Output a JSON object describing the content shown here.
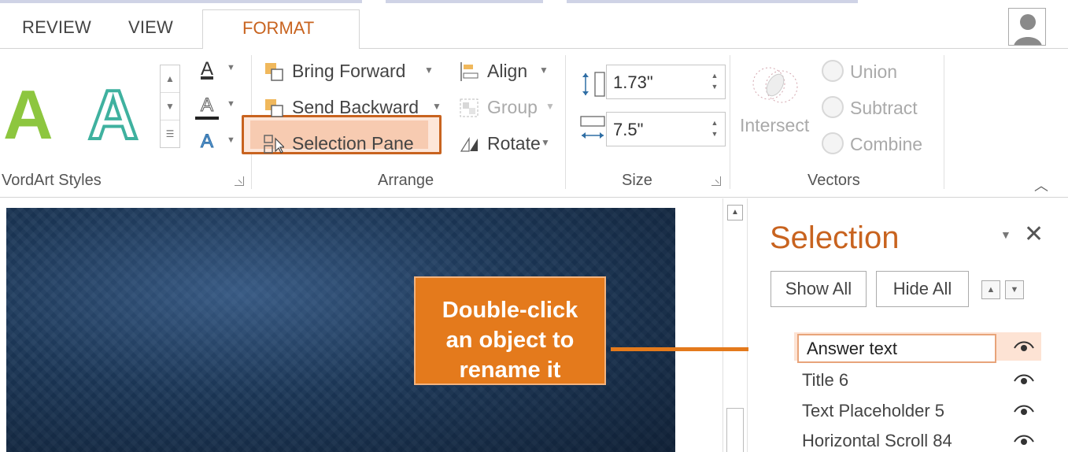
{
  "tabs": [
    {
      "label": "REVIEW"
    },
    {
      "label": "VIEW"
    },
    {
      "label": "FORMAT",
      "active": true
    }
  ],
  "ribbon": {
    "wordart_styles": {
      "label": "VordArt Styles",
      "samples": [
        "A",
        "A"
      ],
      "text_fill_glyph": "A",
      "text_outline_glyph": "A",
      "text_effects_glyph": "A"
    },
    "arrange": {
      "label": "Arrange",
      "bring_forward": "Bring Forward",
      "send_backward": "Send Backward",
      "selection_pane": "Selection Pane",
      "align": "Align",
      "group": "Group",
      "rotate": "Rotate"
    },
    "size": {
      "label": "Size",
      "height": "1.73\"",
      "width": "7.5\""
    },
    "vectors": {
      "label": "Vectors",
      "intersect": "Intersect",
      "union": "Union",
      "subtract": "Subtract",
      "combine": "Combine"
    }
  },
  "callout": {
    "lines": [
      "Double-click",
      "an object to",
      "rename it"
    ]
  },
  "selection_pane": {
    "title": "Selection",
    "show_all": "Show All",
    "hide_all": "Hide All",
    "items": [
      {
        "name": "Answer text",
        "editing": true
      },
      {
        "name": "Title 6"
      },
      {
        "name": "Text Placeholder 5"
      },
      {
        "name": "Horizontal Scroll 84"
      }
    ]
  },
  "colors": {
    "accent": "#c8631f",
    "callout": "#e47a1c",
    "highlight": "#fde3d4",
    "slide_bg": "#1b3656",
    "wordart_green": "#8dc63f",
    "wordart_teal": "#3fb19f"
  },
  "icons": [
    "user-avatar-icon",
    "eye-icon",
    "close-icon",
    "arrow-right-icon",
    "selection-pane-icon"
  ]
}
